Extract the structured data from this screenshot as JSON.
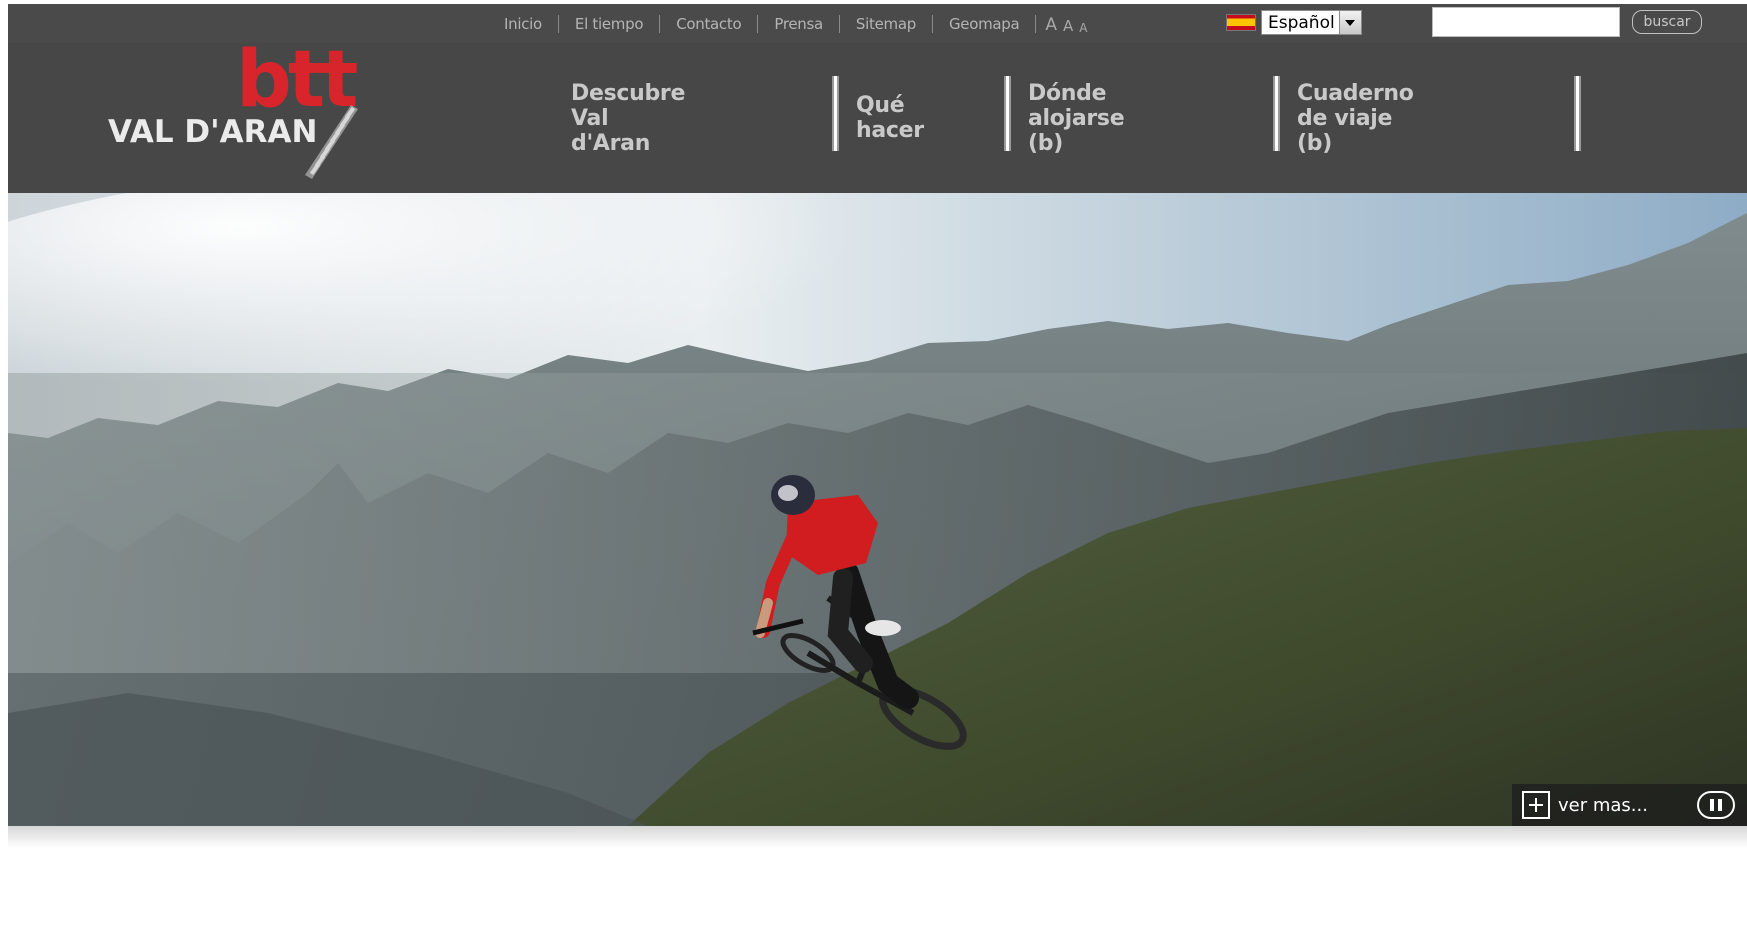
{
  "utility_bar": {
    "links": [
      "Inicio",
      "El tiempo",
      "Contacto",
      "Prensa",
      "Sitemap",
      "Geomapa"
    ],
    "font_sizes": [
      "A",
      "A",
      "A"
    ],
    "language": "Español",
    "search_placeholder": "",
    "search_button": "buscar"
  },
  "logo": {
    "btt": "btt",
    "val_daran": "VAL D'ARAN"
  },
  "main_nav": [
    "Descubre Val d'Aran",
    "Qué hacer",
    "Dónde alojarse (b)",
    "Cuaderno de viaje (b)"
  ],
  "hero": {
    "ver_mas": "ver mas..."
  },
  "colors": {
    "header_bg": "#474747",
    "utility_bg": "#4a4a4a",
    "nav_text": "#c9c9c9",
    "logo_red": "#d8252b"
  },
  "icons": [
    "spain-flag-icon",
    "dropdown-arrow-icon",
    "tire-track-icon",
    "plus-icon",
    "pause-icon"
  ]
}
